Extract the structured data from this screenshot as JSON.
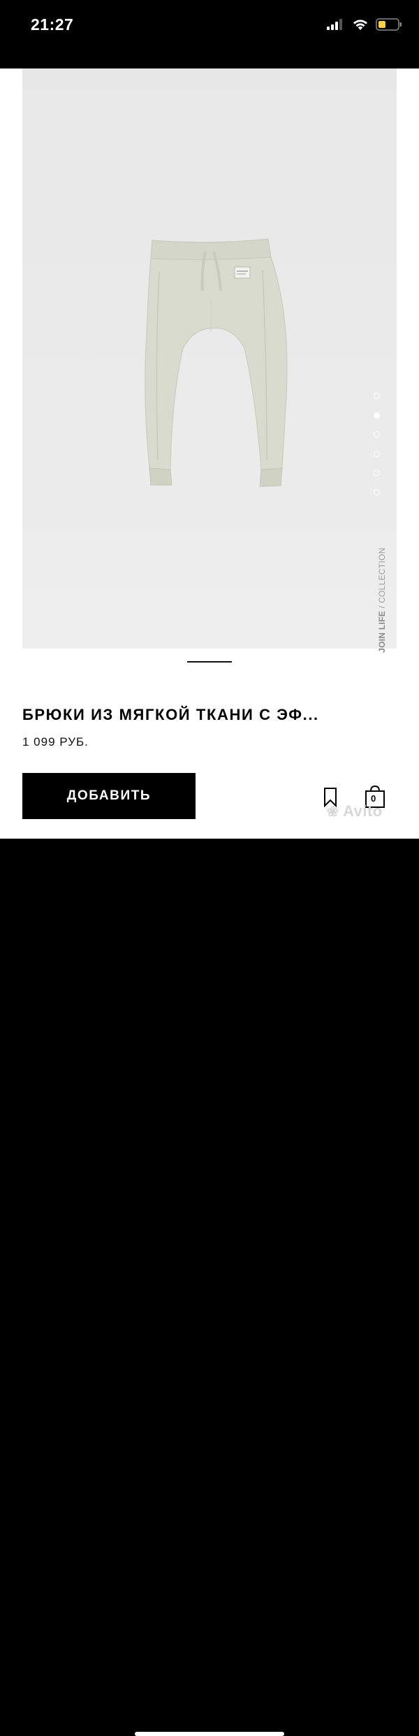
{
  "status_bar": {
    "time": "21:27",
    "icons": [
      "signal-icon",
      "wifi-icon",
      "battery-icon"
    ],
    "battery_color": "#f6d046"
  },
  "gallery": {
    "image": "beige-jogger-pants-photo",
    "background_color": "#eaeaea",
    "pants_color": "#d8dacd",
    "dots_count": 6,
    "active_dot_index": 1,
    "vertical_label_bold": "JOIN LIFE",
    "vertical_label_rest": " / COLLECTION"
  },
  "product": {
    "title": "БРЮКИ ИЗ МЯГКОЙ ТКАНИ С ЭФ...",
    "price": "1 099 РУБ."
  },
  "actions": {
    "add_label": "ДОБАВИТЬ",
    "bookmark_icon": "bookmark-icon",
    "bag_icon": "shopping-bag-icon",
    "bag_count": "0"
  },
  "watermark": {
    "text": "Avito"
  }
}
